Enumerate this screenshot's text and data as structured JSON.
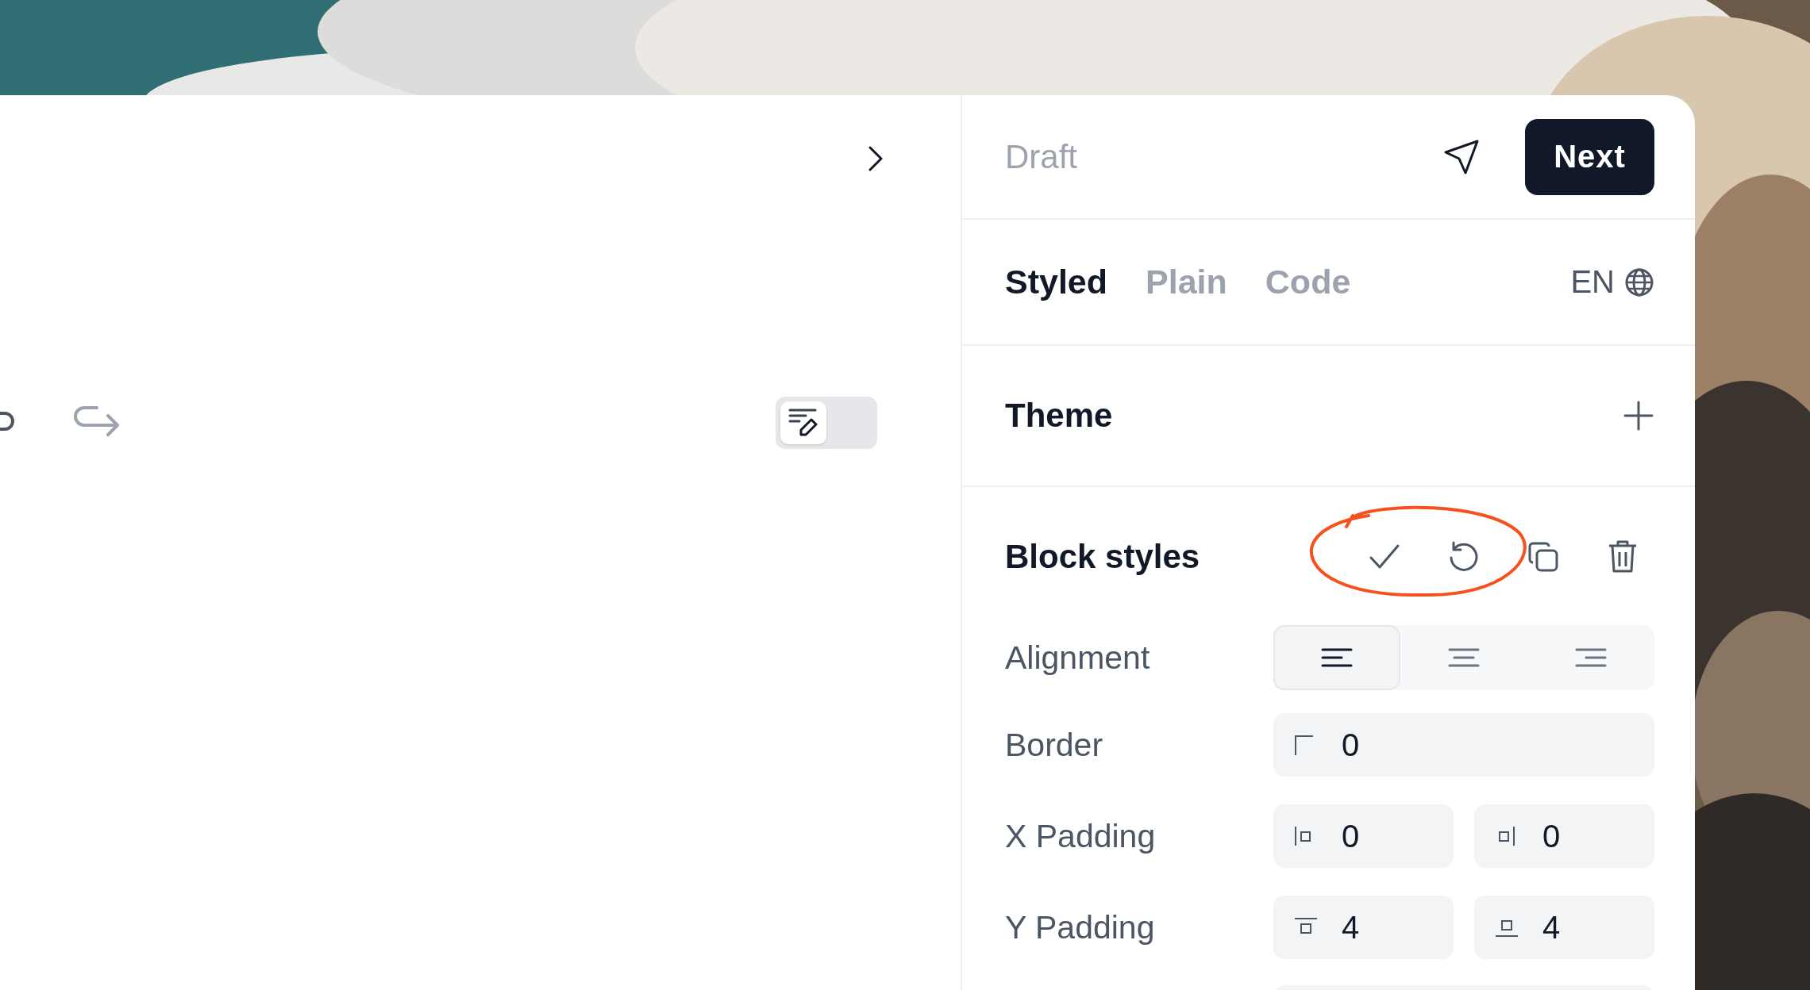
{
  "view_toggle": {
    "on": false
  },
  "status": "Draft",
  "primary_button": "Next",
  "tabs": [
    {
      "label": "Styled",
      "selected": true
    },
    {
      "label": "Plain",
      "selected": false
    },
    {
      "label": "Code",
      "selected": false
    }
  ],
  "language": "EN",
  "theme": {
    "title": "Theme"
  },
  "block_styles": {
    "title": "Block styles",
    "alignment": {
      "label": "Alignment",
      "options": [
        {
          "kind": "left",
          "selected": true
        },
        {
          "kind": "center",
          "selected": false
        },
        {
          "kind": "right",
          "selected": false
        }
      ]
    },
    "fields": [
      {
        "label": "Border",
        "inputs": [
          {
            "kind": "corner",
            "value": "0"
          }
        ]
      },
      {
        "label": "X Padding",
        "inputs": [
          {
            "kind": "left",
            "value": "0"
          },
          {
            "kind": "right",
            "value": "0"
          }
        ]
      },
      {
        "label": "Y Padding",
        "inputs": [
          {
            "kind": "top",
            "value": "4"
          },
          {
            "kind": "bottom",
            "value": "4"
          }
        ]
      }
    ]
  }
}
